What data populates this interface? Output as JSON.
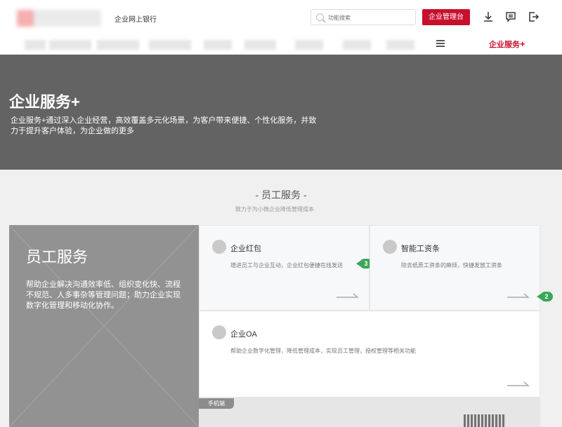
{
  "header": {
    "bank_name": "企业网上银行",
    "search_placeholder": "功能搜索",
    "admin_button": "企业管理台",
    "icons": [
      "download-icon",
      "message-icon",
      "logout-icon"
    ]
  },
  "nav": {
    "menu_icon": "menu-icon",
    "active_item": "企业服务"
  },
  "banner": {
    "title": "企业服务+",
    "description": "企业服务+通过深入企业经营，高效覆盖多元化场景，为客户带来便捷、个性化服务，并致力于提升客户体验，为企业做的更多"
  },
  "section": {
    "title": "- 员工服务 -",
    "subtitle": "致力于为小微企业降低管理成本"
  },
  "feature": {
    "title": "员工服务",
    "description": "帮助企业解决沟通效率低、组织变化快、流程不规范、人多事杂等管理问题；助力企业实现数字化管理和移动化协作。"
  },
  "services": [
    {
      "name": "企业红包",
      "desc": "增进员工与企业互动，企业红包便捷在线发送",
      "badge": "3"
    },
    {
      "name": "智能工资条",
      "desc": "除去纸质工资条的麻烦，快捷发放工资条",
      "badge": "2"
    },
    {
      "name": "企业OA",
      "desc": "帮助企业数字化管理，降低管理成本，实现员工管理，授权管理等相关功能"
    }
  ],
  "mobile_tag": "手机端",
  "colors": {
    "brand_red": "#c8102e",
    "banner_gray": "#636363",
    "badge_green": "#3aa757"
  }
}
